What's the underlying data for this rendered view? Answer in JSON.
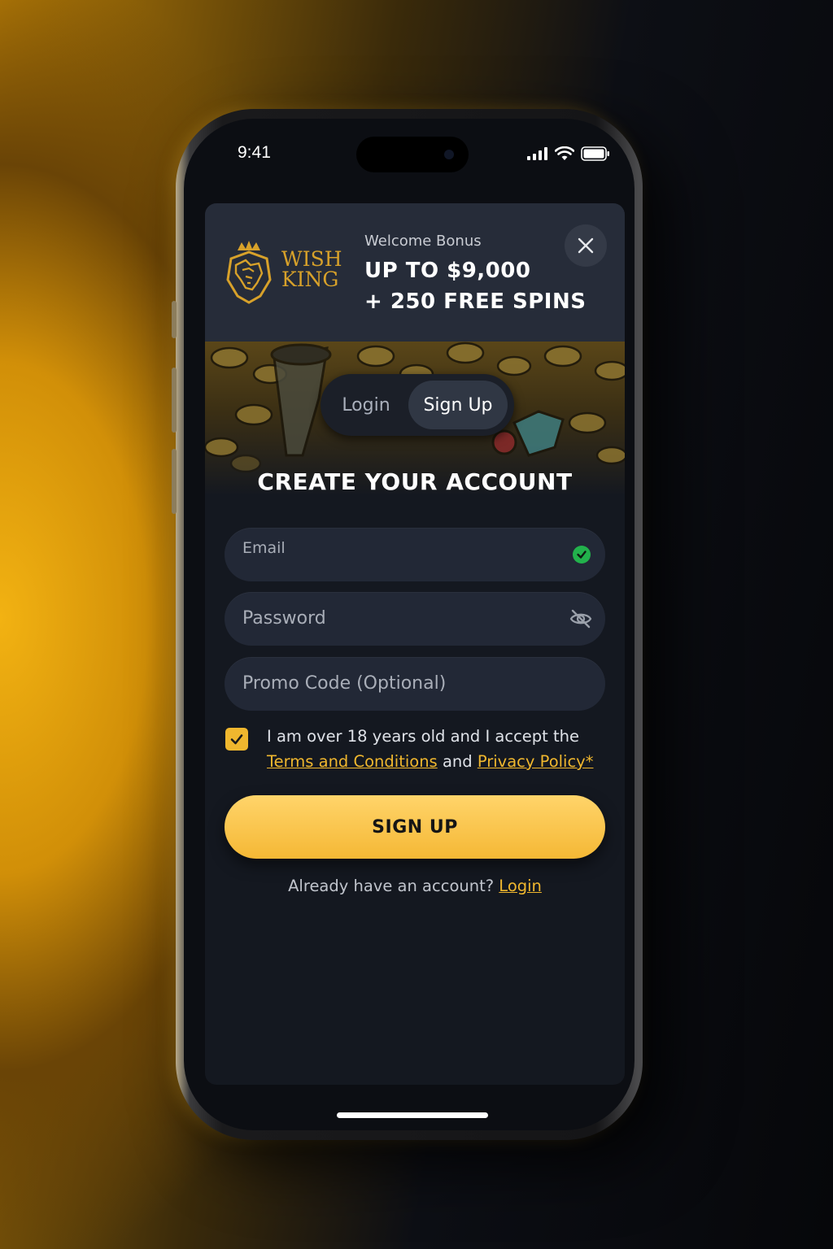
{
  "status_bar": {
    "time": "9:41",
    "icons": [
      "signal-icon",
      "wifi-icon",
      "battery-icon"
    ]
  },
  "banner": {
    "logo_line1": "WISH",
    "logo_line2": "KING",
    "bonus_label": "Welcome Bonus",
    "bonus_line1": "UP TO $9,000",
    "bonus_line2": "+ 250 FREE SPINS",
    "close_icon": "close-icon"
  },
  "tabs": {
    "login": "Login",
    "signup": "Sign Up",
    "active": "signup"
  },
  "form": {
    "heading": "CREATE YOUR ACCOUNT",
    "email_label": "Email",
    "email_valid": true,
    "password_placeholder": "Password",
    "promo_placeholder": "Promo Code (Optional)",
    "consent_checked": true,
    "consent_text": "I am over 18 years old and I accept the",
    "terms_link": "Terms and Conditions",
    "consent_and": "and",
    "privacy_link": "Privacy Policy*",
    "submit_label": "SIGN UP"
  },
  "footer": {
    "prompt": "Already have an account?",
    "login_link": "Login"
  },
  "colors": {
    "accent": "#f0b72e",
    "background": "#141820",
    "success": "#22b24c"
  }
}
